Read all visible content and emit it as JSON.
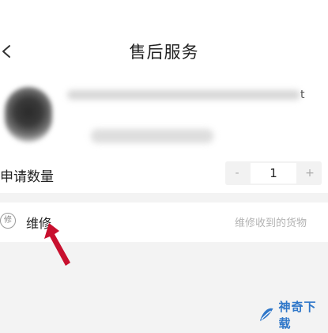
{
  "header": {
    "title": "售后服务",
    "back_icon": "chevron-left-icon"
  },
  "product": {
    "thumbnail": "blurred-product-image",
    "name_line_mark": "t"
  },
  "quantity": {
    "label": "申请数量",
    "minus_label": "-",
    "value": "1",
    "plus_label": "+"
  },
  "service_option": {
    "icon_text": "修",
    "label": "维修",
    "description": "维修收到的货物"
  },
  "watermark": {
    "text": "神奇下载",
    "color": "#2f77c9"
  },
  "colors": {
    "background": "#f3f3f3",
    "card": "#ffffff",
    "arrow": "#c8102e"
  }
}
